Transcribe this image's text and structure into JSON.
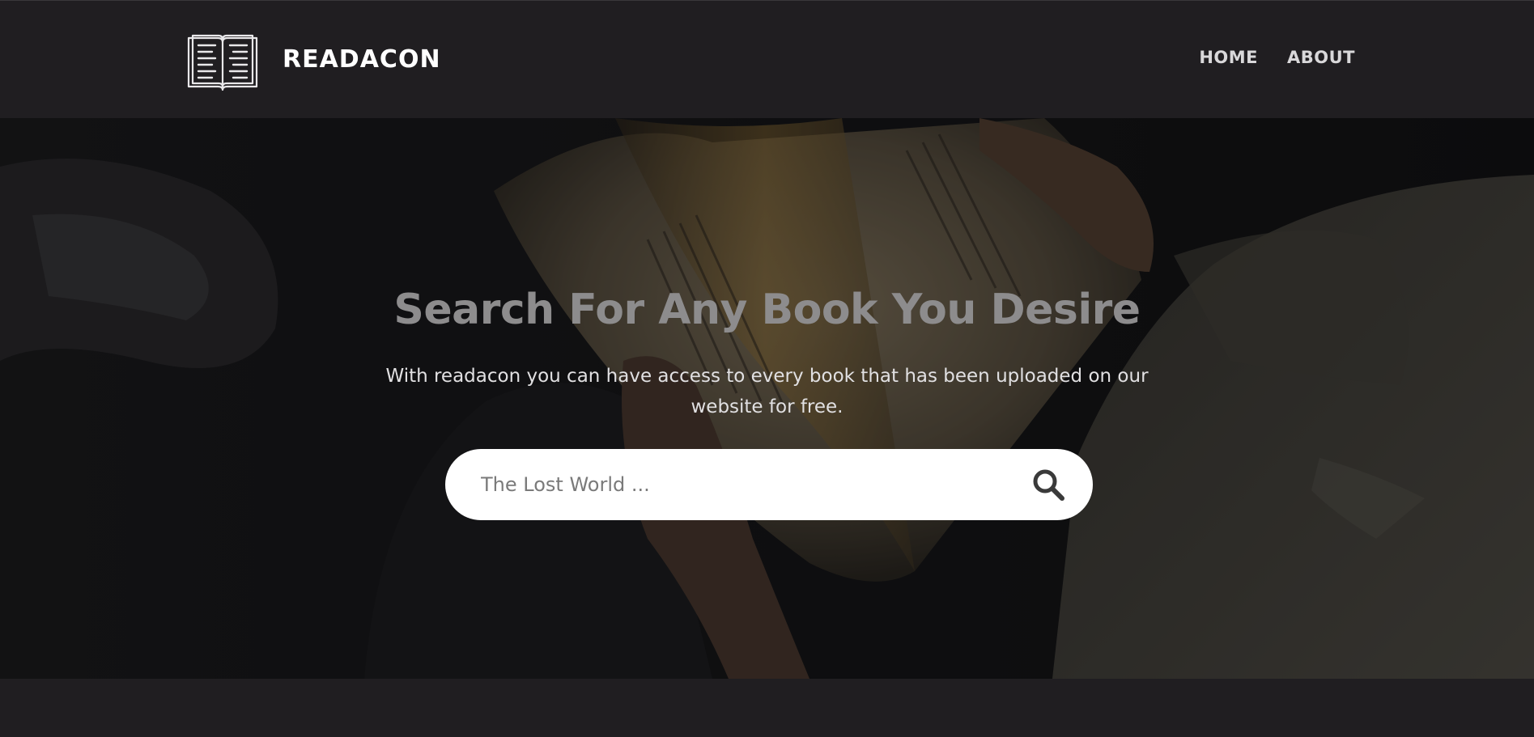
{
  "header": {
    "brand": "READACON",
    "logo_icon": "open-book-icon",
    "nav": [
      {
        "label": "HOME"
      },
      {
        "label": "ABOUT"
      }
    ]
  },
  "hero": {
    "title": "Search For Any Book You Desire",
    "subtitle": "With readacon you can have access to every book that has been uploaded on our website for free.",
    "search": {
      "placeholder": "The Lost World ...",
      "value": "",
      "icon": "search-icon"
    },
    "background_image": "person-reading-book-photo"
  },
  "colors": {
    "background": "#201e21",
    "title": "#8d8c8d",
    "nav_text": "#d9d8da",
    "search_bg": "#ffffff"
  }
}
